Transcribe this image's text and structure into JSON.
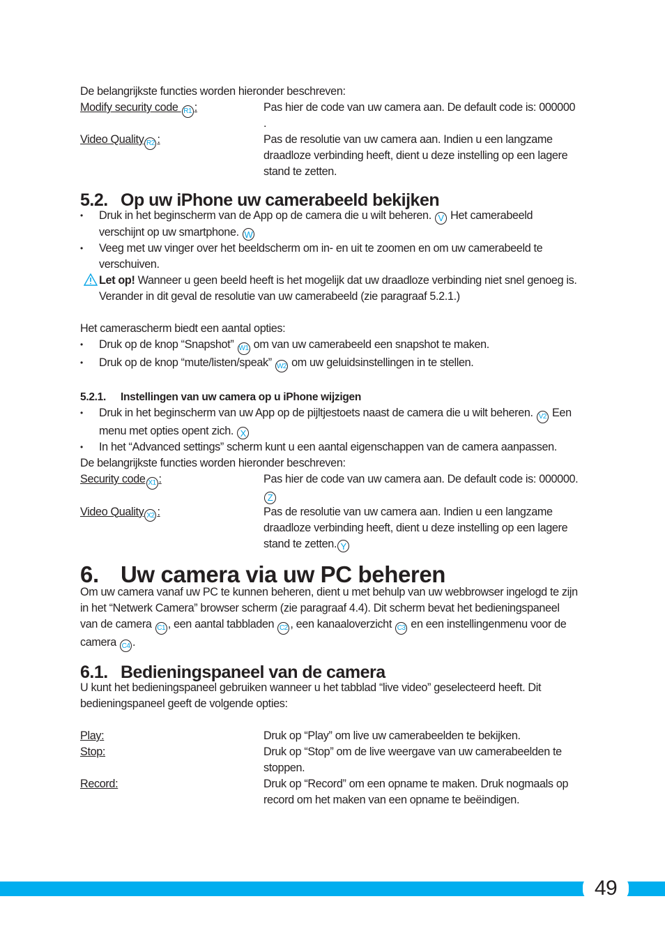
{
  "section_prev": {
    "intro": "De belangrijkste functies worden hieronder beschreven:",
    "items": [
      {
        "term": "Modify security code ",
        "badge": "R1",
        "colon": ":",
        "desc": "Pas hier de code van uw camera aan. De default code is: 000000 ."
      },
      {
        "term": "Video Quality",
        "badge": "R2",
        "colon": ":",
        "desc": "Pas de resolutie van uw camera aan. Indien u een langzame draadloze verbinding heeft, dient u deze instelling op een lagere stand te zetten."
      }
    ]
  },
  "section_5_2": {
    "number": "5.2.",
    "title": "Op uw iPhone uw camerabeeld bekijken",
    "bullets": [
      {
        "a": "Druk in het beginscherm van de App op de camera die u wilt beheren. ",
        "badge1": "V",
        "b": " Het camerabeeld verschijnt op uw smartphone. ",
        "badge2": "W"
      },
      {
        "a": "Veeg met uw vinger over het beeldscherm om in- en uit te zoomen en om uw camerabeeld te verschuiven."
      }
    ],
    "warning": {
      "bold": "Let op!",
      "text": " Wanneer u geen beeld heeft is het mogelijk dat uw draadloze verbinding niet snel genoeg is. Verander in dit geval de resolutie van uw camerabeeld (zie paragraaf 5.2.1.)"
    },
    "options_intro": "Het camerascherm biedt een aantal opties:",
    "options": [
      {
        "a": "Druk op de knop “Snapshot” ",
        "badge": "W1",
        "b": " om van uw camerabeeld een snapshot te maken."
      },
      {
        "a": "Druk op de knop “mute/listen/speak” ",
        "badge": "W2",
        "b": " om uw geluidsinstellingen in te stellen."
      }
    ]
  },
  "section_5_2_1": {
    "number": "5.2.1.",
    "title": "Instellingen van uw camera op u iPhone wijzigen",
    "bullets": [
      {
        "a": "Druk in het beginscherm van uw App op de pijltjestoets naast de camera die u wilt beheren. ",
        "badge1": "V2",
        "b": " Een menu met opties opent zich. ",
        "badge2": "X"
      },
      {
        "a": "In het “Advanced settings” scherm kunt u een aantal eigenschappen van de camera aanpassen."
      }
    ],
    "intro": "De belangrijkste functies worden hieronder beschreven:",
    "items": [
      {
        "term": "Security code",
        "badge": "X1",
        "colon": ":",
        "desc": "Pas hier de code van uw camera aan. De default code is: 000000.",
        "desc_badge": "Z"
      },
      {
        "term": "Video Quality",
        "badge": "X2",
        "colon": ":",
        "desc": "Pas de resolutie van uw camera aan. Indien u een langzame draadloze verbinding heeft, dient u deze instelling op een lagere stand te zetten.",
        "desc_badge": "Y"
      }
    ]
  },
  "section_6": {
    "number": "6.",
    "title": "Uw camera via uw PC beheren",
    "p1": "Om uw camera vanaf uw PC te kunnen beheren, dient u met behulp van uw webbrowser ingelogd te zijn in het “Netwerk Camera” browser scherm (zie paragraaf 4.4). Dit scherm bevat het bedieningspaneel van de camera ",
    "b1": "C1",
    "p2": ", een aantal tabbladen ",
    "b2": "C2",
    "p3": ", een kanaaloverzicht ",
    "b3": "C3",
    "p4": " en een instellingenmenu voor de camera ",
    "b4": "C4",
    "p5": "."
  },
  "section_6_1": {
    "number": "6.1.",
    "title": "Bedieningspaneel van de camera",
    "intro": "U kunt het bedieningspaneel gebruiken wanneer u het tabblad “live video” geselecteerd heeft. Dit bedieningspaneel geeft de volgende opties:",
    "items": [
      {
        "term": "Play:",
        "desc": "Druk op “Play” om live uw camerabeelden te bekijken."
      },
      {
        "term": "Stop:",
        "desc": "Druk op “Stop” om de live weergave van uw camerabeelden te stoppen."
      },
      {
        "term": "Record:",
        "desc": "Druk op “Record” om een opname te maken. Druk nogmaals op record om het maken van een opname te beëindigen."
      }
    ]
  },
  "footer": {
    "page_number": "49",
    "accent_color": "#00aeef",
    "badge_color": "#0aa6e6"
  }
}
